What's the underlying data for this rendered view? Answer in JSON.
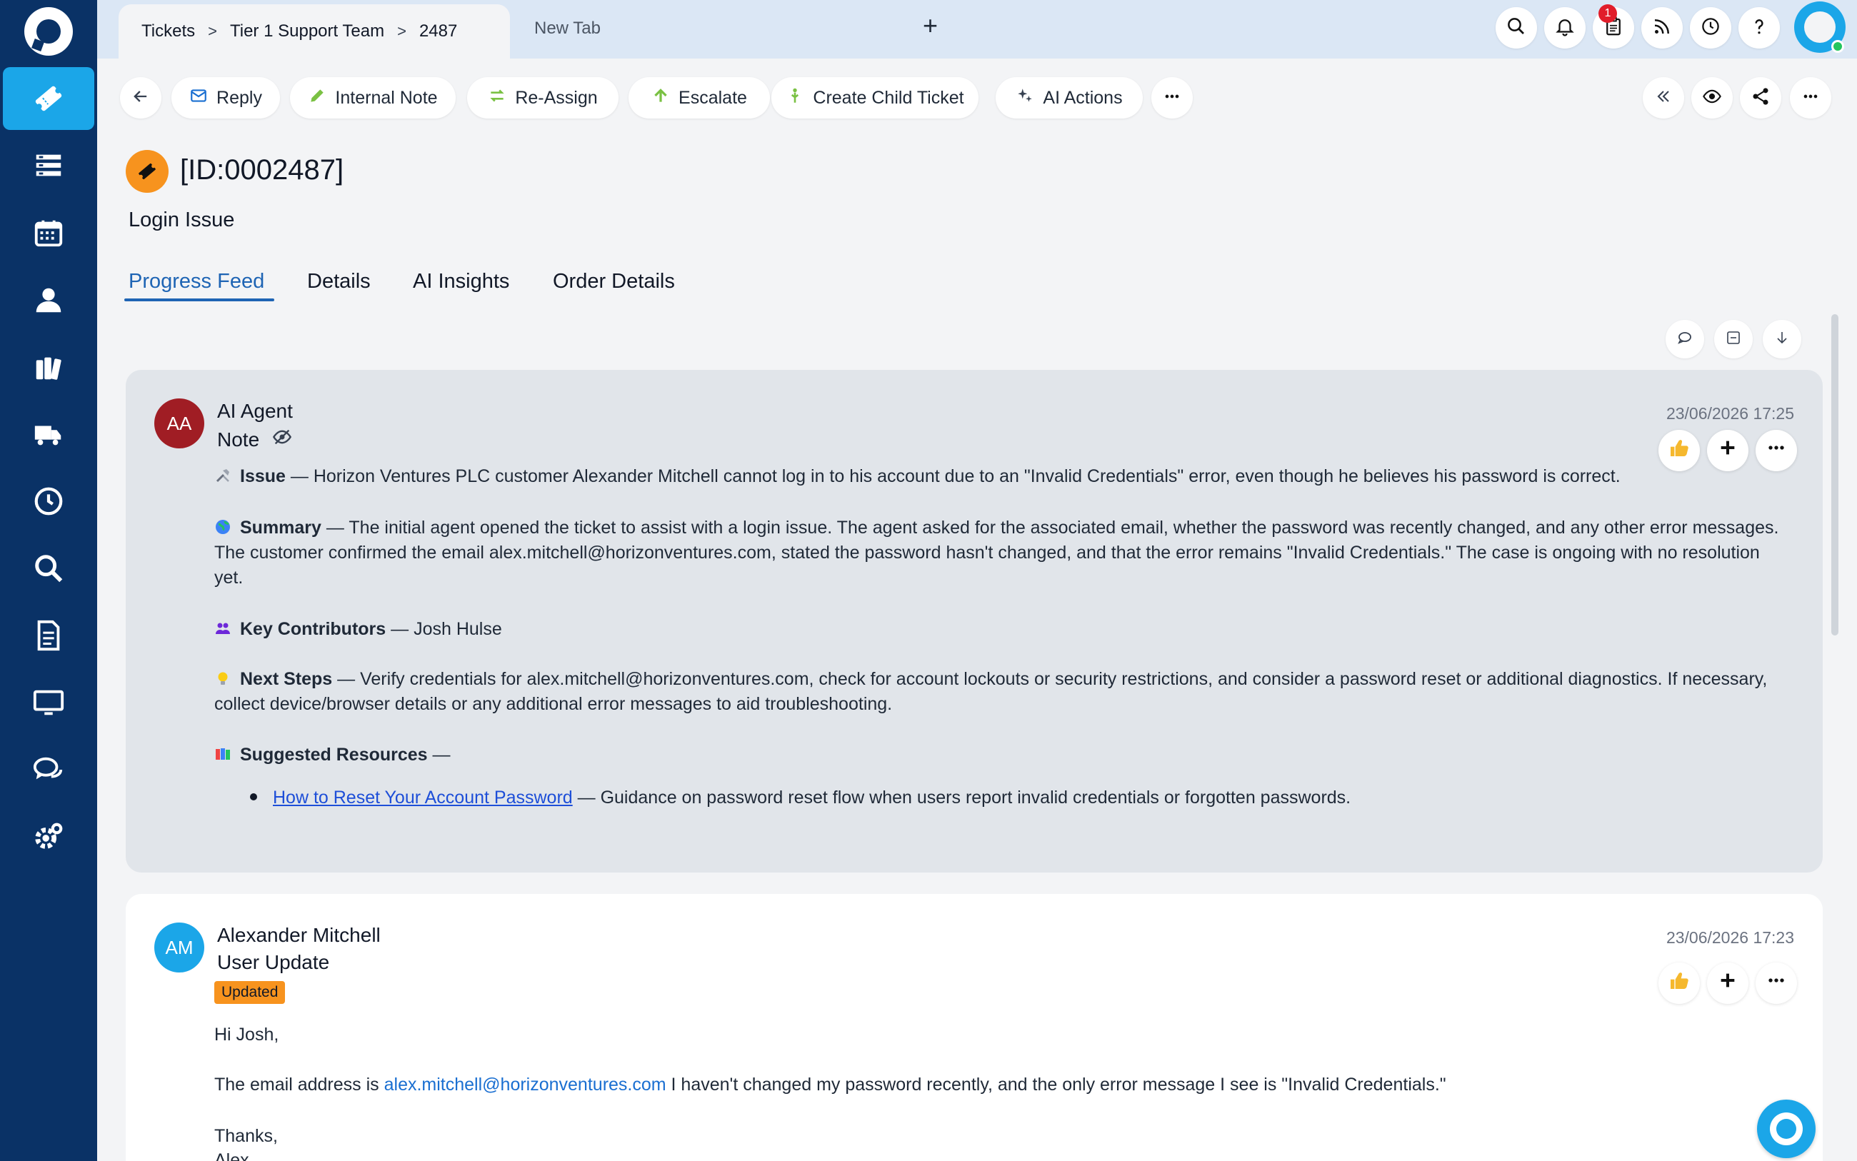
{
  "topbar": {
    "breadcrumb": [
      "Tickets",
      "Tier 1 Support Team",
      "2487"
    ],
    "breadcrumb_sep": ">",
    "new_tab_label": "New Tab",
    "add_tab_symbol": "+",
    "notification_count": "1"
  },
  "toolbar": {
    "reply": "Reply",
    "internal_note": "Internal Note",
    "reassign": "Re-Assign",
    "escalate": "Escalate",
    "create_child": "Create Child Ticket",
    "ai_actions": "AI Actions"
  },
  "ticket": {
    "id": "[ID:0002487]",
    "subject": "Login Issue"
  },
  "tabs": [
    "Progress Feed",
    "Details",
    "AI Insights",
    "Order Details"
  ],
  "feed": {
    "ai_card": {
      "avatar_initials": "AA",
      "author": "AI Agent",
      "kind": "Note",
      "timestamp": "23/06/2026 17:25",
      "issue_label": "Issue",
      "issue_text": " — Horizon Ventures PLC customer Alexander Mitchell cannot log in to his account due to an \"Invalid Credentials\" error, even though he believes his password is correct.",
      "summary_label": "Summary",
      "summary_text": " — The initial agent opened the ticket to assist with a login issue. The agent asked for the associated email, whether the password was recently changed, and any other error messages. The customer confirmed the email alex.mitchell@horizonventures.com, stated the password hasn't changed, and that the error remains \"Invalid Credentials.\" The case is ongoing with no resolution yet.",
      "contributors_label": "Key Contributors",
      "contributors_text": " — Josh Hulse",
      "next_steps_label": "Next Steps",
      "next_steps_text": " — Verify credentials for alex.mitchell@horizonventures.com, check for account lockouts or security restrictions, and consider a password reset or additional diagnostics. If necessary, collect device/browser details or any additional error messages to aid troubleshooting.",
      "resources_label": "Suggested Resources",
      "resources_text": " —",
      "resource_link": "How to Reset Your Account Password",
      "resource_desc": " — Guidance on password reset flow when users report invalid credentials or forgotten passwords."
    },
    "user_card": {
      "avatar_initials": "AM",
      "author": "Alexander Mitchell",
      "kind": "User Update",
      "badge": "Updated",
      "timestamp": "23/06/2026 17:23",
      "greeting": "Hi Josh,",
      "body_prefix": "The email address is ",
      "email": "alex.mitchell@horizonventures.com",
      "body_suffix": " I haven't changed my password recently, and the only error message I see is \"Invalid Credentials.\"",
      "signoff": "Thanks,",
      "signature": "Alex"
    }
  },
  "colors": {
    "sidebar": "#0a3266",
    "accent": "#1ba6e8",
    "tab_active": "#1e64b4",
    "orange": "#f7931e",
    "ai_avatar": "#a01d24",
    "user_avatar": "#1ba6e8"
  }
}
